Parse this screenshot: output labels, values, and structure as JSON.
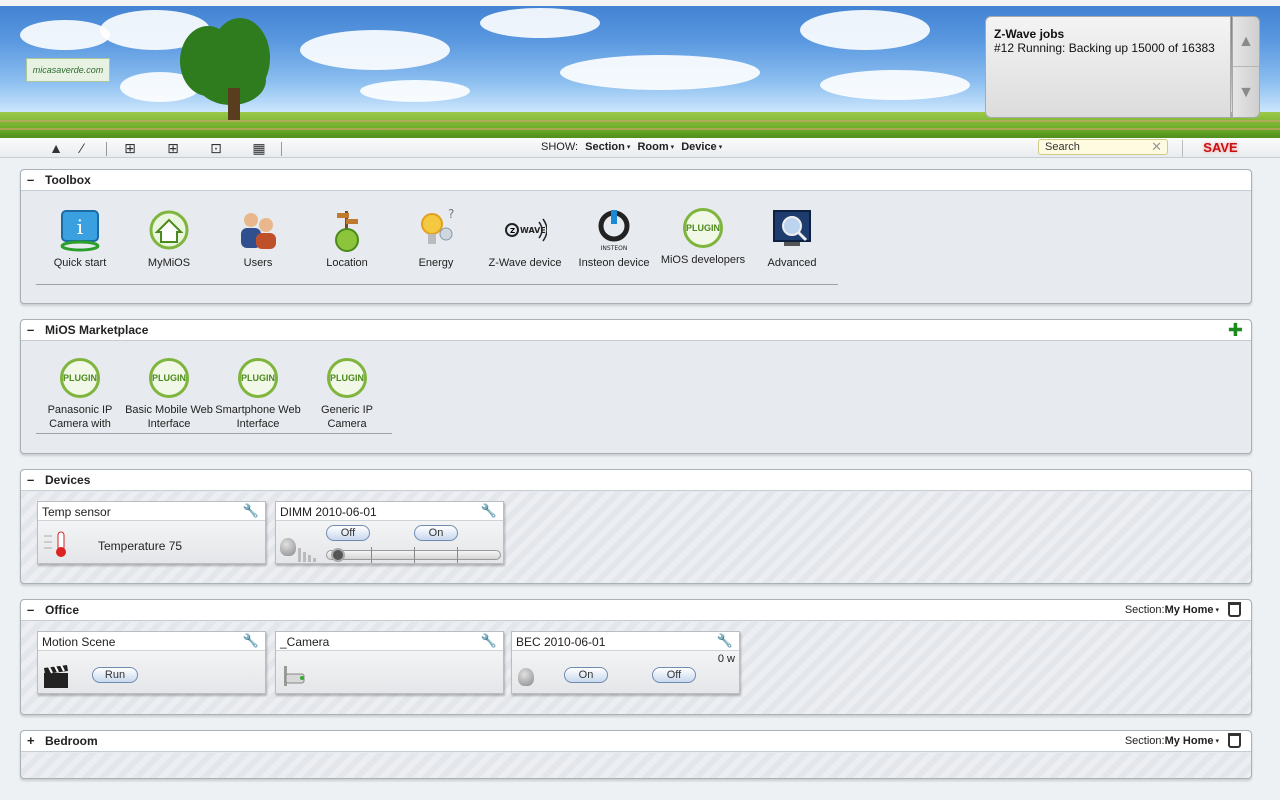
{
  "logo": {
    "text": "micasaverde.com"
  },
  "zwave": {
    "title": "Z-Wave jobs",
    "status": "#12 Running: Backing up 15000 of 16383"
  },
  "toolbar": {
    "show_label": "SHOW:",
    "filters": [
      "Section",
      "Room",
      "Device"
    ],
    "search_placeholder": "Search",
    "save_label": "SAVE"
  },
  "toolbox": {
    "title": "Toolbox",
    "items": [
      {
        "label": "Quick start",
        "icon": "info-screen-icon"
      },
      {
        "label": "MyMiOS",
        "icon": "house-icon"
      },
      {
        "label": "Users",
        "icon": "users-icon"
      },
      {
        "label": "Location",
        "icon": "globe-signpost-icon"
      },
      {
        "label": "Energy",
        "icon": "energy-bulb-icon"
      },
      {
        "label": "Z-Wave device",
        "icon": "zwave-logo-icon"
      },
      {
        "label": "Insteon device",
        "icon": "insteon-logo-icon"
      },
      {
        "label": "MiOS developers",
        "icon": "plugin-icon"
      },
      {
        "label": "Advanced",
        "icon": "magnifier-monitor-icon"
      }
    ]
  },
  "marketplace": {
    "title": "MiOS Marketplace",
    "plugin_badge": "PLUGIN",
    "items": [
      {
        "label": "Panasonic IP Camera with"
      },
      {
        "label": "Basic Mobile Web Interface"
      },
      {
        "label": "Smartphone Web Interface"
      },
      {
        "label": "Generic IP Camera"
      }
    ]
  },
  "devices": {
    "title": "Devices",
    "temp_sensor": {
      "name": "Temp sensor",
      "reading": "Temperature 75"
    },
    "dimmer": {
      "name": "DIMM 2010-06-01",
      "off": "Off",
      "on": "On",
      "level": 0
    }
  },
  "office": {
    "title": "Office",
    "section_label": "Section:",
    "section_value": "My Home",
    "motion_scene": {
      "name": "Motion Scene",
      "run": "Run"
    },
    "camera": {
      "name": "_Camera"
    },
    "bec": {
      "name": "BEC 2010-06-01",
      "power": "0 w",
      "on": "On",
      "off": "Off"
    }
  },
  "bedroom": {
    "title": "Bedroom",
    "section_label": "Section:",
    "section_value": "My Home"
  },
  "glyphs": {
    "minus": "–",
    "plus": "+",
    "add": "✚",
    "caret": "▾",
    "wrench": "🔧",
    "close": "✕",
    "up": "▲",
    "down": "▼"
  }
}
